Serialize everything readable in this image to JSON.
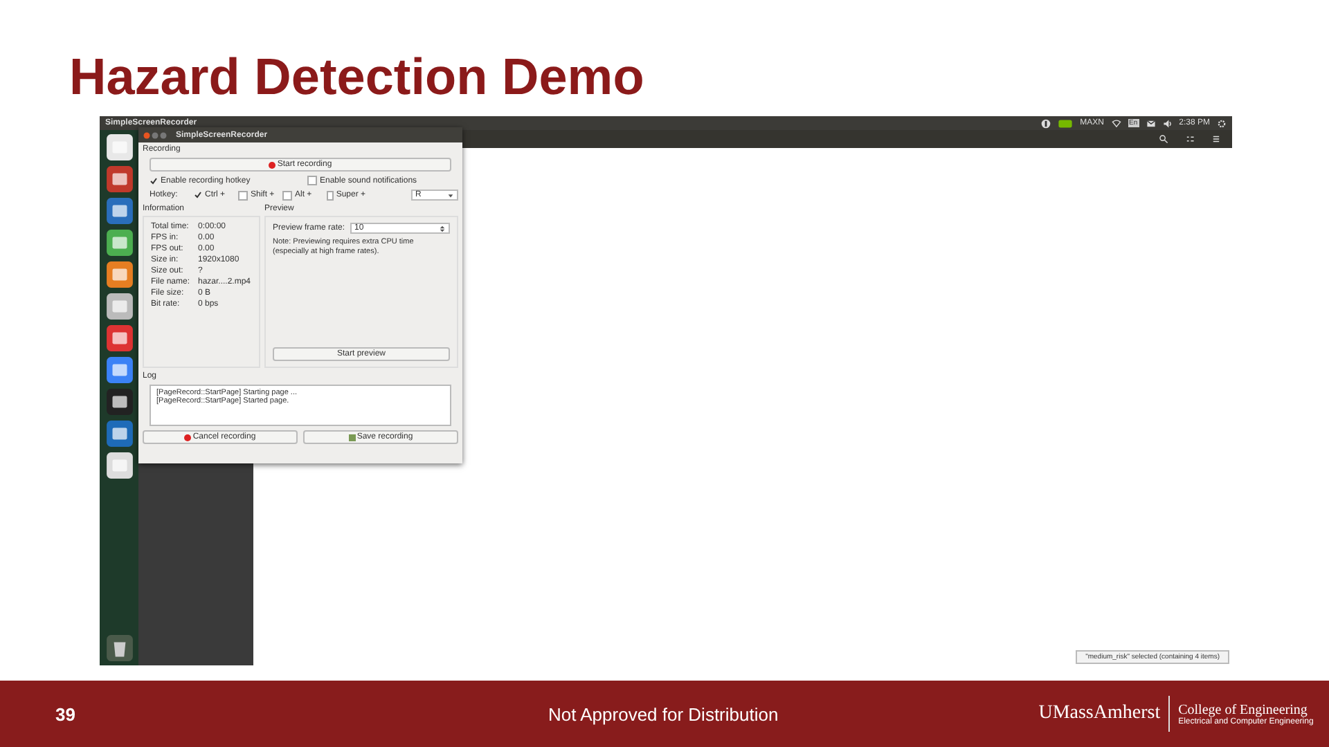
{
  "slide": {
    "title": "Hazard Detection Demo",
    "page_number": "39",
    "footer_text": "Not Approved  for Distribution",
    "logo": {
      "name": "UMassAmherst",
      "college": "College of Engineering",
      "department": "Electrical and Computer Engineering"
    }
  },
  "top_bar": {
    "app_title": "SimpleScreenRecorder",
    "power_mode": "MAXN",
    "keyboard": "En",
    "time": "2:38 PM"
  },
  "file_manager": {
    "status": "\"medium_risk\" selected  (containing 4 items)"
  },
  "recorder": {
    "title": "SimpleScreenRecorder",
    "recording_label": "Recording",
    "start_button": "Start recording",
    "hotkey_toggle": {
      "label": "Enable recording hotkey",
      "checked": true
    },
    "sound_toggle": {
      "label": "Enable sound notifications",
      "checked": false
    },
    "hotkey_label": "Hotkey:",
    "modifiers": [
      {
        "label": "Ctrl +",
        "checked": true
      },
      {
        "label": "Shift +",
        "checked": false
      },
      {
        "label": "Alt +",
        "checked": false
      },
      {
        "label": "Super +",
        "checked": false
      }
    ],
    "key": "R",
    "information_label": "Information",
    "information": [
      {
        "label": "Total time:",
        "value": "0:00:00"
      },
      {
        "label": "FPS in:",
        "value": "0.00"
      },
      {
        "label": "FPS out:",
        "value": "0.00"
      },
      {
        "label": "Size in:",
        "value": "1920x1080"
      },
      {
        "label": "Size out:",
        "value": "?"
      },
      {
        "label": "File name:",
        "value": "hazar....2.mp4"
      },
      {
        "label": "File size:",
        "value": "0 B"
      },
      {
        "label": "Bit rate:",
        "value": "0 bps"
      }
    ],
    "preview_label": "Preview",
    "frame_rate_label": "Preview frame rate:",
    "frame_rate": "10",
    "note": "Note: Previewing requires extra CPU time (especially at high frame rates).",
    "preview_button": "Start preview",
    "log_label": "Log",
    "log": [
      "[PageRecord::StartPage] Starting page ...",
      "[PageRecord::StartPage] Started page."
    ],
    "cancel_button": "Cancel recording",
    "save_button": "Save recording"
  }
}
